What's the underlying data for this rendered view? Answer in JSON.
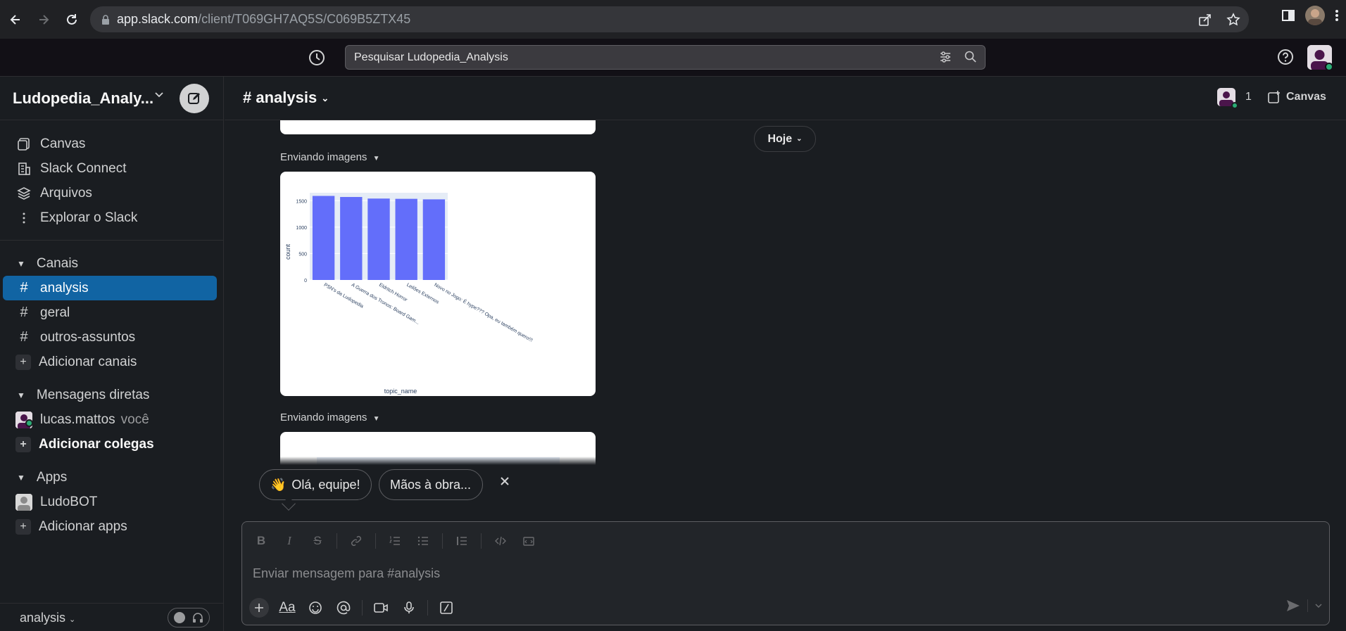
{
  "browser": {
    "url_host": "app.slack.com",
    "url_path": "/client/T069GH7AQ5S/C069B5ZTX45"
  },
  "topbar": {
    "search_placeholder": "Pesquisar Ludopedia_Analysis"
  },
  "sidebar": {
    "workspace_name": "Ludopedia_Analy...",
    "nav": [
      {
        "label": "Canvas",
        "icon": "canvas-icon"
      },
      {
        "label": "Slack Connect",
        "icon": "building-icon"
      },
      {
        "label": "Arquivos",
        "icon": "layers-icon"
      },
      {
        "label": "Explorar o Slack",
        "icon": "more-vertical-icon"
      }
    ],
    "channels_header": "Canais",
    "channels": [
      {
        "label": "analysis",
        "active": true
      },
      {
        "label": "geral",
        "active": false
      },
      {
        "label": "outros-assuntos",
        "active": false
      }
    ],
    "add_channels": "Adicionar canais",
    "dm_header": "Mensagens diretas",
    "dms": [
      {
        "label": "lucas.mattos",
        "suffix": "você"
      }
    ],
    "add_colleagues": "Adicionar colegas",
    "apps_header": "Apps",
    "apps": [
      {
        "label": "LudoBOT"
      }
    ],
    "add_apps": "Adicionar apps",
    "huddle_channel": "analysis"
  },
  "channel": {
    "title": "# analysis",
    "member_count": "1",
    "canvas_label": "Canvas"
  },
  "messages": {
    "date_label": "Hoje",
    "sending_1": "Enviando imagens",
    "sending_2": "Enviando imagens"
  },
  "chart_data": {
    "type": "bar",
    "categories": [
      "PSN's da Ludopedia",
      "A Guerra dos Tronos: Board Gam...",
      "Eldritch Horror",
      "Leilões Externos",
      "Novo no Jogo: É hype??? Opa, eu também quero!!!"
    ],
    "values": [
      1590,
      1570,
      1540,
      1535,
      1525
    ],
    "xlabel": "topic_name",
    "ylabel": "count",
    "yticks": [
      0,
      500,
      1000,
      1500
    ],
    "ylim": [
      0,
      1650
    ],
    "bar_color": "#636efa",
    "plot_bg": "#e5ecf6"
  },
  "suggestions": {
    "hello": "Olá, equipe!",
    "hello_emoji": "👋",
    "work": "Mãos à obra..."
  },
  "composer": {
    "placeholder": "Enviar mensagem para #analysis",
    "aa_label": "Aa"
  },
  "colors": {
    "active_channel": "#1164a3",
    "online": "#2bac76",
    "avatar": "#4a154b"
  }
}
